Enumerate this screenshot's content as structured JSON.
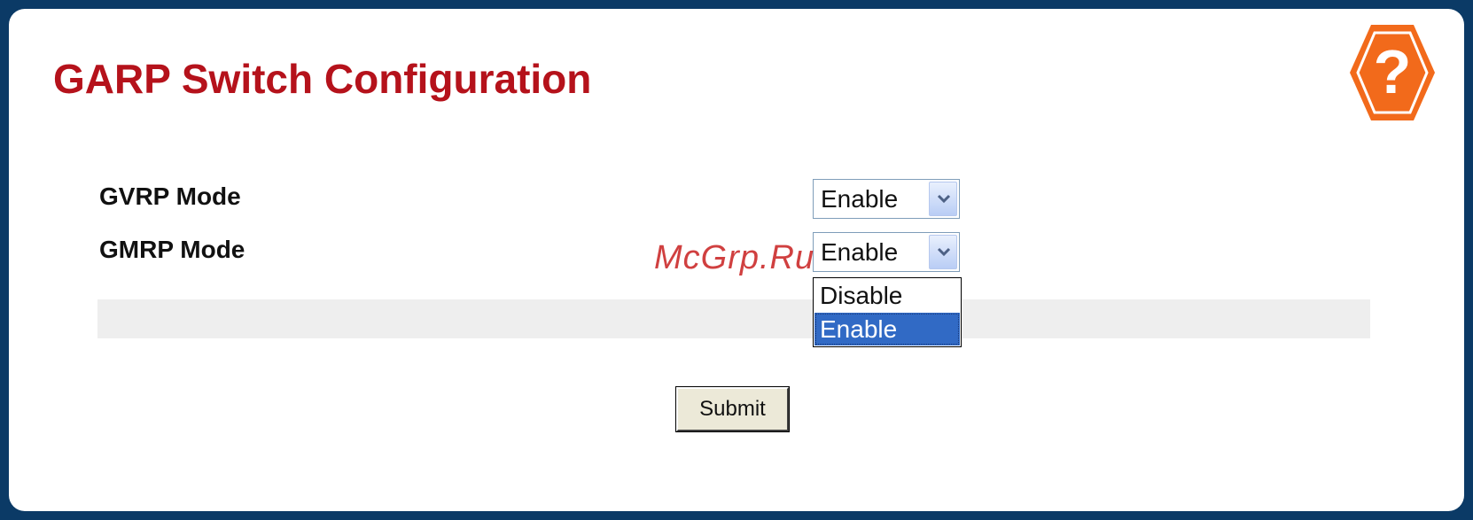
{
  "page": {
    "title": "GARP Switch Configuration"
  },
  "help": {
    "icon": "help-question-icon",
    "glyph": "?",
    "color": "#f26a1b"
  },
  "form": {
    "gvrp": {
      "label": "GVRP Mode",
      "value": "Enable"
    },
    "gmrp": {
      "label": "GMRP Mode",
      "value": "Enable",
      "options": [
        "Disable",
        "Enable"
      ],
      "highlighted": "Enable"
    }
  },
  "actions": {
    "submit_label": "Submit"
  },
  "watermark": "McGrp.Ru",
  "colors": {
    "title": "#b5121b",
    "frame": "#0b3a66",
    "selection": "#316ac5"
  }
}
